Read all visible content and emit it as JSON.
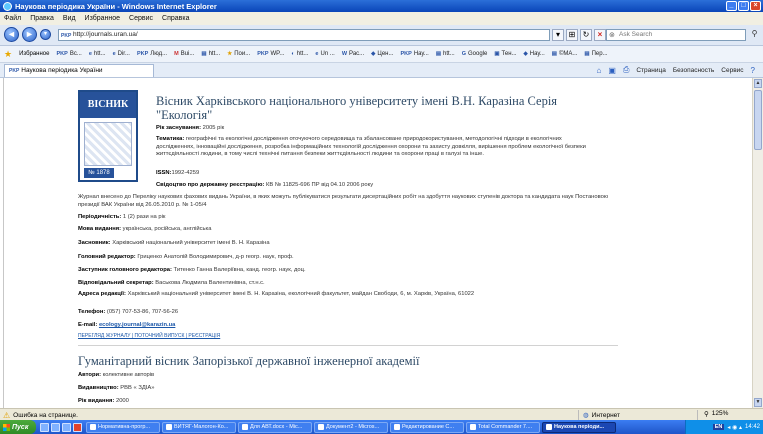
{
  "window": {
    "title": "Наукова періодика України - Windows Internet Explorer",
    "buttons": [
      "_",
      "□",
      "×"
    ]
  },
  "menu": {
    "items": [
      "Файл",
      "Правка",
      "Вид",
      "Избранное",
      "Сервис",
      "Справка"
    ]
  },
  "address": {
    "url": "http://journals.uran.ua/",
    "search_placeholder": "Ask Search"
  },
  "favorites": {
    "label": "Избранное",
    "items": [
      "Вс...",
      "htt...",
      "Dir...",
      "Люд...",
      "Bui...",
      "htt...",
      "Пои...",
      "WP...",
      "htt...",
      "Un ...",
      "Рас...",
      "Цен...",
      "Нау...",
      "htt...",
      "Google",
      "Тен...",
      "Нау...",
      "©MA...",
      "Пер..."
    ]
  },
  "tab": {
    "label": "Наукова періодика України"
  },
  "commands": {
    "page": "Страница",
    "safety": "Безопасность",
    "tools": "Сервис"
  },
  "journal1": {
    "title": "Вісник Харківського національного університету імені В.Н. Каразіна Серія \"Екологія\"",
    "cover_name": "ВІСНИК",
    "cover_number": "№ 1878",
    "founded_label": "Рік заснування:",
    "founded_value": "2005 рік",
    "topics_label": "Тематика:",
    "topics_value": "географічні та екологічні дослідження оточуючого середовища та збалансоване природокористування, методологічні підходи в екологічних дослідженнях, інноваційні дослідження, розробка інформаційних технологій дослідження охорони та захисту довкілля, вирішення проблем екологічної безпеки життєдіяльності людини, в тому числі технічні питання безпеки життєдіяльності людини та охорони праці в галузі та інше.",
    "issn_label": "ISSN:",
    "issn_value": "1992-4259",
    "cert_label": "Свідоцтво про державну реєстрацію:",
    "cert_value": "КВ № 11825-696 ПР від 04.10 2006 року",
    "vak_note": "Журнал внесено до Переліку наукових фахових видань України, в яких можуть публікуватися результати дисертаційних робіт на здобуття наукових ступенів доктора та кандидата наук Постановою президії ВАК України від 26.05.2010 р. № 1-05/4",
    "periodicity_label": "Періодичність:",
    "periodicity_value": "1 (2) рази на рік",
    "languages_label": "Мова видання:",
    "languages_value": "українська, російська, англійська",
    "founder_label": "Засновник:",
    "founder_value": "Харківський національний університет імені В. Н. Каразіна",
    "chief_label": "Головний редактор:",
    "chief_value": "Гриценко Анатолій Володимирович, д-р геогр. наук, проф.",
    "deputy_label": "Заступник головного редактора:",
    "deputy_value": "Титенко Ганна Валеріївна, канд. геогр. наук, доц.",
    "secretary_label": "Відповідальний секретар:",
    "secretary_value": "Васькова Людмила Валентинівна, ст.н.с.",
    "address_label": "Адреса редакції:",
    "address_value": "Харківський національний університет імені В. Н. Каразіна, екологічний факультет, майдан Свободи, 6, м. Харків, Україна, 61022",
    "phone_label": "Телефон:",
    "phone_value": "(057) 707-53-86, 707-56-26",
    "email_label": "E-mail:",
    "email_value": "ecology.journal@karazin.ua",
    "links": "ПЕРЕГЛЯД ЖУРНАЛУ | ПОТОЧНИЙ ВИПУСК | РЕЄСТРАЦІЯ"
  },
  "journal2": {
    "title": "Гуманітарний вісник Запорізької державної інженерної академії",
    "authors_label": "Автори:",
    "authors_value": "колективне авторів",
    "publisher_label": "Видавництво:",
    "publisher_value": "РВВ « ЗДІА»",
    "year_label": "Рік видання:",
    "year_value": "2000"
  },
  "status": {
    "text": "Ошибка на странице.",
    "zone": "Интернет",
    "zoom": "125%"
  },
  "taskbar": {
    "start": "Пуск",
    "tasks": [
      "Нормативна-прогр...",
      "ВИТЯГ-Малогон-Ко...",
      "Для АВТ.docx - Mic...",
      "Документ2 - Micros...",
      "Редактирование С...",
      "Total Commander 7....",
      "Наукова періоди..."
    ],
    "lang": "EN",
    "time": "14:42"
  }
}
